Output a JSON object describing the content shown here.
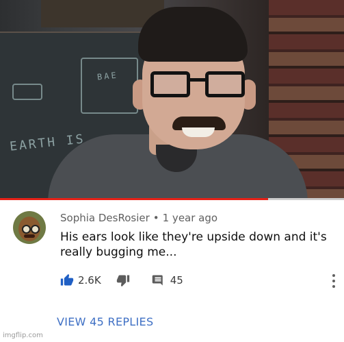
{
  "video": {
    "chalk_text": "EARTH IS",
    "chalk_note": "BAE",
    "progress": 0.78
  },
  "comment": {
    "author": "Sophia DesRosier",
    "separator": "•",
    "time": "1 year ago",
    "text": "His ears look like they're upside down and it's really bugging me...",
    "likes": "2.6K",
    "replies_count": "45",
    "view_replies": "VIEW 45 REPLIES"
  },
  "icons": {
    "like": "thumbs-up-icon",
    "dislike": "thumbs-down-icon",
    "reply": "comment-icon",
    "more": "more-vert-icon"
  },
  "colors": {
    "accent_blue": "#3e6fc4",
    "progress_red": "#e62117",
    "meta_grey": "#606060"
  },
  "watermark": "imgflip.com"
}
